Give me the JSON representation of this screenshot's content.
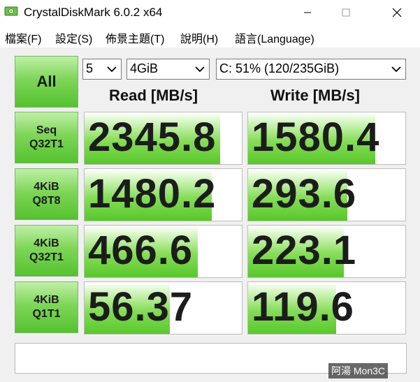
{
  "window": {
    "title": "CrystalDiskMark 6.0.2 x64"
  },
  "menu": {
    "items": [
      {
        "label": "檔案(F)"
      },
      {
        "label": "設定(S)"
      },
      {
        "label": "佈景主題(T)"
      },
      {
        "label": "說明(H)"
      },
      {
        "label": "語言(Language)"
      }
    ]
  },
  "controls": {
    "all_label": "All",
    "count_value": "5",
    "size_value": "4GiB",
    "drive_value": "C: 51% (120/235GiB)"
  },
  "headers": {
    "read": "Read [MB/s]",
    "write": "Write [MB/s]"
  },
  "tests": [
    {
      "line1": "Seq",
      "line2": "Q32T1",
      "read": "2345.8",
      "write": "1580.4",
      "read_fill": 0.86,
      "write_fill": 0.81
    },
    {
      "line1": "4KiB",
      "line2": "Q8T8",
      "read": "1480.2",
      "write": "293.6",
      "read_fill": 0.81,
      "write_fill": 0.63
    },
    {
      "line1": "4KiB",
      "line2": "Q32T1",
      "read": "466.6",
      "write": "223.1",
      "read_fill": 0.72,
      "write_fill": 0.61
    },
    {
      "line1": "4KiB",
      "line2": "Q1T1",
      "read": "56.37",
      "write": "119.6",
      "read_fill": 0.54,
      "write_fill": 0.56
    }
  ],
  "watermark": "阿湯 Mon3C",
  "colors": {
    "bar_green": "#58c72b",
    "button_green": "#7ed658"
  }
}
